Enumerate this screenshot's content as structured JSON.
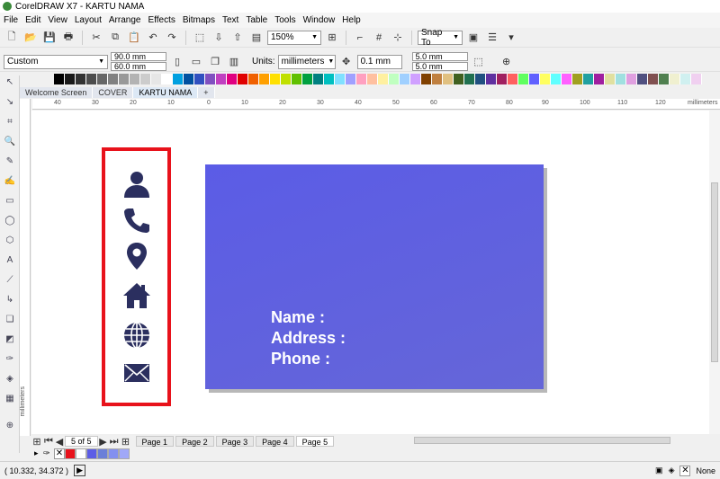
{
  "window": {
    "title": "CorelDRAW X7 - KARTU NAMA"
  },
  "menu": [
    "File",
    "Edit",
    "View",
    "Layout",
    "Arrange",
    "Effects",
    "Bitmaps",
    "Text",
    "Table",
    "Tools",
    "Window",
    "Help"
  ],
  "standard_toolbar": {
    "zoom": "150%",
    "snap_to": "Snap To"
  },
  "property_bar": {
    "preset": "Custom",
    "width": "90.0 mm",
    "height": "60.0 mm",
    "units_label": "Units:",
    "units": "millimeters",
    "nudge": "0.1 mm",
    "dup_x": "5.0 mm",
    "dup_y": "5.0 mm"
  },
  "doc_tabs": [
    "Welcome Screen",
    "COVER",
    "KARTU NAMA"
  ],
  "ruler": {
    "h_ticks": [
      "40",
      "30",
      "20",
      "10",
      "0",
      "10",
      "20",
      "30",
      "40",
      "50",
      "60",
      "70",
      "80",
      "90",
      "100",
      "110",
      "120"
    ],
    "unit": "millimeters",
    "v_unit": "millimeters"
  },
  "card": {
    "lines": [
      "Name :",
      "Address :",
      "Phone :"
    ],
    "color": "#5c5de6"
  },
  "icons": [
    "user-icon",
    "phone-icon",
    "location-pin-icon",
    "home-icon",
    "globe-icon",
    "mail-icon"
  ],
  "page_nav": {
    "count": "5 of 5",
    "pages": [
      "Page 1",
      "Page 2",
      "Page 3",
      "Page 4",
      "Page 5"
    ],
    "active": "Page 5"
  },
  "status": {
    "coords": "( 10.332, 34.372 )",
    "fill": "None"
  },
  "palette": [
    "#000000",
    "#1a1a1a",
    "#333333",
    "#4d4d4d",
    "#666666",
    "#808080",
    "#999999",
    "#b3b3b3",
    "#cccccc",
    "#e6e6e6",
    "#ffffff",
    "#00a0e0",
    "#0050a0",
    "#3050c0",
    "#8050c0",
    "#c040c0",
    "#e00080",
    "#e00000",
    "#f06000",
    "#ffa000",
    "#ffe000",
    "#c0e000",
    "#60c000",
    "#00a040",
    "#008080",
    "#00c0c0",
    "#80e0ff",
    "#a0a0ff",
    "#ffa0c0",
    "#ffc0a0",
    "#fff0a0",
    "#c0ffc0",
    "#a0d0ff",
    "#d0a0ff",
    "#804000",
    "#c08040",
    "#e0c080",
    "#406020",
    "#207050",
    "#205080",
    "#6030a0",
    "#a02060",
    "#ff6060",
    "#60ff60",
    "#6060ff",
    "#ffff60",
    "#60ffff",
    "#ff60ff",
    "#a0a020",
    "#20a0a0",
    "#a020a0",
    "#e0e0a0",
    "#a0e0e0",
    "#e0a0e0",
    "#505080",
    "#805050",
    "#508050",
    "#f0f0d0",
    "#d0f0f0",
    "#f0d0f0"
  ],
  "doc_palette": [
    "#e8121b",
    "#ffffff",
    "#5c5de6",
    "#6b7fd8",
    "#8390f0",
    "#a0a8f8"
  ]
}
